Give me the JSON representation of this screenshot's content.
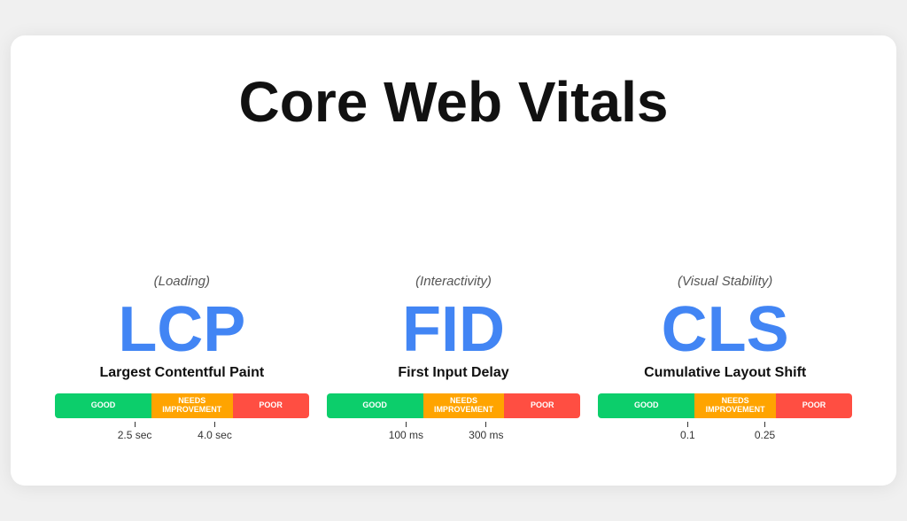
{
  "page": {
    "title": "Core Web Vitals",
    "background": "#f0f0f0"
  },
  "metrics": [
    {
      "id": "lcp",
      "abbr": "LCP",
      "name": "Largest Contentful Paint",
      "subtitle": "(Loading)",
      "icon_type": "paint-roller",
      "bar": {
        "good_pct": 38,
        "needs_pct": 32,
        "poor_pct": 30,
        "good_label": "GOOD",
        "needs_label": "NEEDS\nIMPROVEMENT",
        "poor_label": "POOR"
      },
      "markers": [
        {
          "value": "2.5 sec",
          "position": "left"
        },
        {
          "value": "4.0 sec",
          "position": "right"
        }
      ]
    },
    {
      "id": "fid",
      "abbr": "FID",
      "name": "First Input Delay",
      "subtitle": "(Interactivity)",
      "icon_type": "hand-tap",
      "bar": {
        "good_pct": 38,
        "needs_pct": 32,
        "poor_pct": 30,
        "good_label": "GOOD",
        "needs_label": "NEEDS\nIMPROVEMENT",
        "poor_label": "POOR"
      },
      "markers": [
        {
          "value": "100 ms",
          "position": "left"
        },
        {
          "value": "300 ms",
          "position": "right"
        }
      ]
    },
    {
      "id": "cls",
      "abbr": "CLS",
      "name": "Cumulative Layout Shift",
      "subtitle": "(Visual Stability)",
      "icon_type": "layout-shift",
      "bar": {
        "good_pct": 38,
        "needs_pct": 32,
        "poor_pct": 30,
        "good_label": "GOOD",
        "needs_label": "NEEDS\nIMPROVEMENT",
        "poor_label": "POOR"
      },
      "markers": [
        {
          "value": "0.1",
          "position": "left"
        },
        {
          "value": "0.25",
          "position": "right"
        }
      ]
    }
  ]
}
